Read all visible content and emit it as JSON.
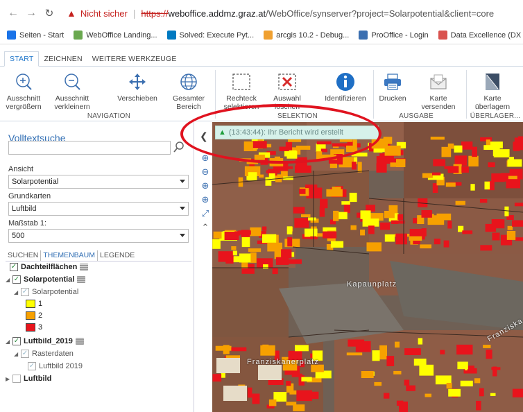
{
  "browser": {
    "insecure_label": "Nicht sicher",
    "url_scheme": "https://",
    "url_host": "weboffice.addmz.graz.at",
    "url_path": "/WebOffice/synserver?project=Solarpotential&client=core",
    "bookmarks": [
      {
        "label": "Seiten - Start",
        "icon": "google-icon",
        "color": "#1a73e8"
      },
      {
        "label": "WebOffice Landing...",
        "icon": "weboffice-icon",
        "color": "#6aa84f"
      },
      {
        "label": "Solved: Execute Pyt...",
        "icon": "esri-icon",
        "color": "#0079c1"
      },
      {
        "label": "arcgis 10.2 - Debug...",
        "icon": "arcgis-icon",
        "color": "#f0a030"
      },
      {
        "label": "ProOffice - Login",
        "icon": "prooffice-icon",
        "color": "#3b6fb0"
      },
      {
        "label": "Data Excellence (DX",
        "icon": "dx-icon",
        "color": "#d9534f"
      }
    ]
  },
  "app_tabs": [
    "START",
    "ZEICHNEN",
    "WEITERE WERKZEUGE"
  ],
  "ribbon": {
    "tools": [
      {
        "label": "Ausschnitt\nvergrößern",
        "icon": "zoom-in-icon"
      },
      {
        "label": "Ausschnitt\nverkleinern",
        "icon": "zoom-out-icon"
      },
      {
        "label": "Verschieben",
        "icon": "pan-icon"
      },
      {
        "label": "Gesamter\nBereich",
        "icon": "globe-icon"
      },
      {
        "label": "Rechteck\nselektieren",
        "icon": "select-rectangle-icon"
      },
      {
        "label": "Auswahl\nlöschen",
        "icon": "clear-selection-icon"
      },
      {
        "label": "Identifizieren",
        "icon": "info-icon"
      },
      {
        "label": "Drucken",
        "icon": "printer-icon"
      },
      {
        "label": "Karte\nversenden",
        "icon": "mail-icon"
      },
      {
        "label": "Karte\nüberlagern",
        "icon": "overlay-icon"
      }
    ],
    "groups": {
      "navigation": "NAVIGATION",
      "selektion": "SELEKTION",
      "ausgabe": "AUSGABE",
      "ueberlager": "ÜBERLAGER..."
    }
  },
  "left_panel": {
    "search_title": "Volltextsuche",
    "search_value": "",
    "ansicht_label": "Ansicht",
    "ansicht_value": "Solarpotential",
    "grundkarten_label": "Grundkarten",
    "grundkarten_value": "Luftbild",
    "massstab_label": "Maßstab 1:",
    "massstab_value": "500",
    "tabs": [
      "SUCHEN",
      "THEMENBAUM",
      "LEGENDE"
    ],
    "tree": {
      "dachteil": "Dachteilflächen",
      "solarpotential": "Solarpotential",
      "solarpotential_sub": "Solarpotential",
      "legend": [
        {
          "label": "1",
          "color": "#ffff00"
        },
        {
          "label": "2",
          "color": "#f7a000"
        },
        {
          "label": "3",
          "color": "#e8141c"
        }
      ],
      "luftbild2019": "Luftbild_2019",
      "rasterdaten": "Rasterdaten",
      "luftbild2019_sub": "Luftbild 2019",
      "luftbild": "Luftbild"
    }
  },
  "map": {
    "status_message": "(13:43:44): Ihr Bericht wird erstellt",
    "street_labels": [
      "Kapaunplatz",
      "Franziskanerplatz",
      "Franziska"
    ]
  },
  "colors": {
    "accent": "#2f6db3",
    "highlight_ellipse": "#e0131f",
    "solar_1": "#ffff00",
    "solar_2": "#f7a000",
    "solar_3": "#e8141c"
  }
}
